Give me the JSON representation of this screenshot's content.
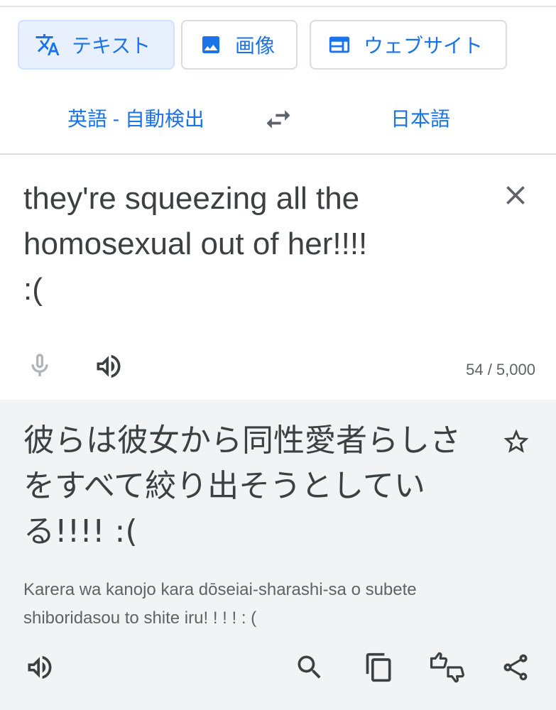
{
  "tabs": [
    {
      "label": "テキスト",
      "icon": "translate-icon",
      "active": true
    },
    {
      "label": "画像",
      "icon": "image-icon",
      "active": false
    },
    {
      "label": "ウェブサイト",
      "icon": "website-icon",
      "active": false
    }
  ],
  "languages": {
    "source": "英語 - 自動検出",
    "target": "日本語",
    "swap_icon": "swap-icon"
  },
  "source": {
    "text": "they're squeezing all the\nhomosexual out of her!!!!\n:(",
    "char_count": "54 / 5,000"
  },
  "result": {
    "text": "彼らは彼女から同性愛者らしさをすべて絞り出そうとしている!!!! :(",
    "romanization": "Karera wa kanojo kara dōseiai-sharashi-sa o subete shiboridasou to shite iru! ! ! ! : ("
  },
  "colors": {
    "accent": "#1a73e8",
    "active_tab_bg": "#e8f0fe",
    "result_bg": "#f1f3f4",
    "text": "#3c4043",
    "muted": "#5f6368"
  }
}
